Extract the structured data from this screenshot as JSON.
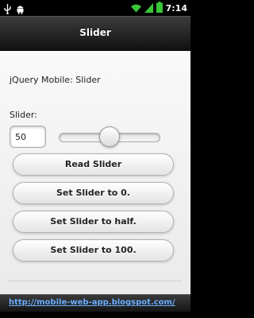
{
  "status_bar": {
    "time": "7:14",
    "left_icons": [
      "usb-icon",
      "android-icon"
    ],
    "right_icons": [
      "wifi-icon",
      "signal-icon",
      "battery-icon"
    ]
  },
  "header": {
    "title": "Slider"
  },
  "content": {
    "intro": "jQuery Mobile: Slider",
    "slider_label": "Slider:",
    "slider_value": "50",
    "slider_min": 0,
    "slider_max": 100,
    "slider_fraction": 0.5
  },
  "buttons": {
    "read": "Read Slider",
    "set_zero": "Set Slider to 0.",
    "set_half": "Set Slider to half.",
    "set_hundred": "Set Slider to 100."
  },
  "footer": {
    "link": "http://mobile-web-app.blogspot.com/"
  },
  "colors": {
    "link": "#6aaeff",
    "wifi": "#39c639",
    "signal": "#39c639",
    "battery": "#39c639"
  }
}
